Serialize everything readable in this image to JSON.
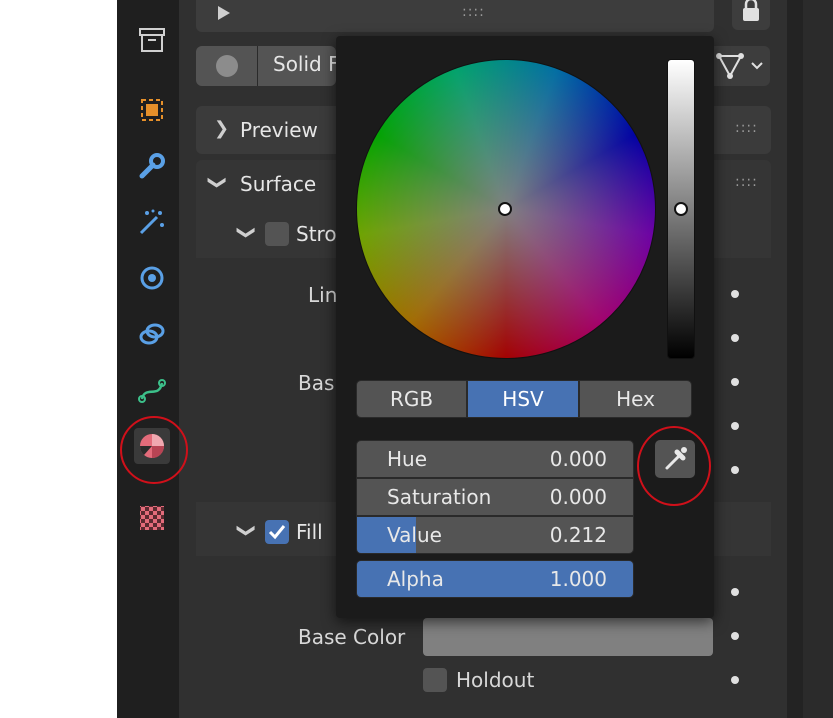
{
  "colors": {
    "accent": "#4772b3",
    "panel": "#303030",
    "annotation": "#d0101a"
  },
  "sidebar": {
    "icons": [
      "archive-icon",
      "object-icon",
      "wrench-icon",
      "particles-icon",
      "physics-icon",
      "constraints-icon",
      "data-icon",
      "material-icon",
      "texture-icon"
    ]
  },
  "header": {
    "solid_label": "Solid F",
    "grip": "::::"
  },
  "sections": {
    "preview": {
      "title": "Preview"
    },
    "surface": {
      "title": "Surface"
    },
    "stroke": {
      "title": "Stro"
    },
    "line_label": "Lin",
    "base_label": "Bas",
    "fill": {
      "title": "Fill"
    },
    "base_color_label": "Base Color",
    "holdout_label": "Holdout"
  },
  "color_picker": {
    "modes": [
      "RGB",
      "HSV",
      "Hex"
    ],
    "active_mode": "HSV",
    "fields": [
      {
        "label": "Hue",
        "value": "0.000"
      },
      {
        "label": "Saturation",
        "value": "0.000"
      },
      {
        "label": "Value",
        "value": "0.212",
        "fill": 0.212
      },
      {
        "label": "Alpha",
        "value": "1.000",
        "fill": 1.0
      }
    ]
  }
}
